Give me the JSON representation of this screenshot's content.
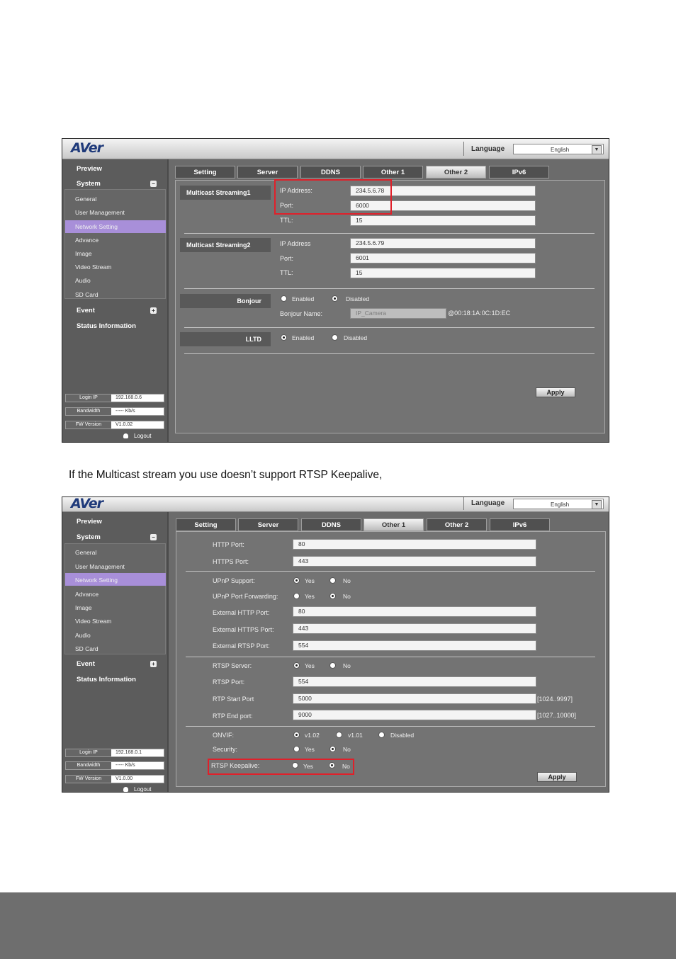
{
  "caption": "If the Multicast stream you use doesn’t support RTSP Keepalive,",
  "common": {
    "logo": "AVer",
    "language_label": "Language",
    "language_value": "English",
    "menu_preview": "Preview",
    "menu_system": "System",
    "menu_event": "Event",
    "menu_status": "Status Information",
    "submenu": [
      "General",
      "User Management",
      "Network Setting",
      "Advance",
      "Image",
      "Video Stream",
      "Audio",
      "SD Card"
    ],
    "info_login_ip_label": "Login IP",
    "info_bandwidth_label": "Bandwidth",
    "info_bandwidth_value": "----- Kb/s",
    "info_fw_label": "FW Version",
    "logout": "Logout",
    "tabs": [
      "Setting",
      "Server",
      "DDNS",
      "Other 1",
      "Other 2",
      "IPv6"
    ],
    "apply": "Apply",
    "yes": "Yes",
    "no": "No",
    "enabled": "Enabled",
    "disabled": "Disabled"
  },
  "shot1": {
    "login_ip": "192.168.0.6",
    "fw_version": "V1.0.02",
    "active_tab": "Other 2",
    "ms1_label": "Multicast Streaming1",
    "ms1_ip_label": "IP Address:",
    "ms1_ip": "234.5.6.78",
    "ms1_port_label": "Port:",
    "ms1_port": "6000",
    "ms1_ttl_label": "TTL:",
    "ms1_ttl": "15",
    "ms2_label": "Multicast Streaming2",
    "ms2_ip_label": "IP Address",
    "ms2_ip": "234.5.6.79",
    "ms2_port_label": "Port:",
    "ms2_port": "6001",
    "ms2_ttl_label": "TTL:",
    "ms2_ttl": "15",
    "bonjour_label": "Bonjour",
    "bonjour_name_label": "Bonjour Name:",
    "bonjour_name_value": "IP_Camera",
    "bonjour_suffix": "@00:18:1A:0C:1D:EC",
    "lltd_label": "LLTD"
  },
  "shot2": {
    "login_ip": "192.168.0.1",
    "fw_version": "V1.0.00",
    "active_tab": "Other 1",
    "http_port_label": "HTTP Port:",
    "http_port": "80",
    "https_port_label": "HTTPS Port:",
    "https_port": "443",
    "upnp_label": "UPnP Support:",
    "upnp_fwd_label": "UPnP Port Forwarding:",
    "ext_http_label": "External HTTP Port:",
    "ext_http": "80",
    "ext_https_label": "External HTTPS Port:",
    "ext_https": "443",
    "ext_rtsp_label": "External RTSP Port:",
    "ext_rtsp": "554",
    "rtsp_server_label": "RTSP Server:",
    "rtsp_port_label": "RTSP Port:",
    "rtsp_port": "554",
    "rtp_start_label": "RTP Start Port",
    "rtp_start": "5000",
    "rtp_start_range": "[1024..9997]",
    "rtp_end_label": "RTP End port:",
    "rtp_end": "9000",
    "rtp_end_range": "[1027..10000]",
    "onvif_label": "ONVIF:",
    "onvif_v102": "v1.02",
    "onvif_v101": "v1.01",
    "security_label": "Security:",
    "keepalive_label": "RTSP Keepalive:"
  }
}
